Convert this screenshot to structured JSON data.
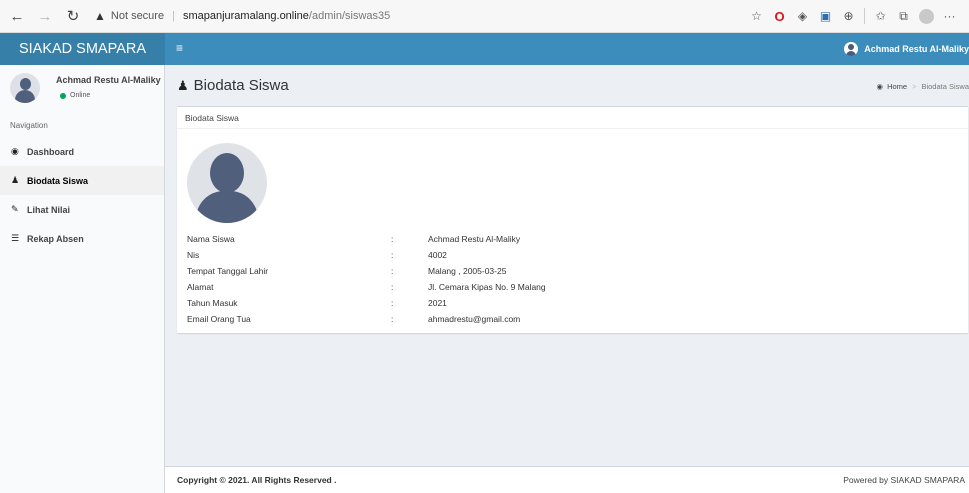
{
  "browser": {
    "back_glyph": "←",
    "forward_glyph": "→",
    "reload_glyph": "↻",
    "warning_glyph": "▲",
    "security_label": "Not secure",
    "url_host": "smapanjuramalang.online",
    "url_path": "/admin/siswas35",
    "icons": [
      "reading-view-icon",
      "opera-icon",
      "extension-icon",
      "flag-icon",
      "globe-icon",
      "favorites-icon",
      "collections-icon",
      "profile-icon",
      "more-icon"
    ],
    "star_glyph": "☆",
    "opera_glyph": "O",
    "ext_glyph": "◈",
    "flag_glyph": "▣",
    "globe_glyph": "⊕",
    "fav_glyph": "✩",
    "collections_glyph": "⧉",
    "more_glyph": "···"
  },
  "header": {
    "brand": "SIAKAD SMAPARA",
    "menu_glyph": "≡",
    "user_name": "Achmad Restu Al-Maliky",
    "bg_color": "#3c8dbc",
    "logo_color": "#367fa9"
  },
  "sidebar": {
    "user_name": "Achmad Restu Al-Maliky",
    "status": "Online",
    "status_color": "#00a65a",
    "nav_header": "Navigation",
    "items": [
      {
        "label": "Dashboard",
        "icon": "dashboard-icon",
        "glyph": "◉"
      },
      {
        "label": "Biodata Siswa",
        "icon": "user-icon",
        "glyph": "♟",
        "active": true
      },
      {
        "label": "Lihat Nilai",
        "icon": "pencil-icon",
        "glyph": "✎"
      },
      {
        "label": "Rekap Absen",
        "icon": "list-icon",
        "glyph": "☰"
      }
    ]
  },
  "page": {
    "title": "Biodata Siswa",
    "title_glyph": "♟",
    "breadcrumb": {
      "home_glyph": "◉",
      "home": "Home",
      "sep": ">",
      "current": "Biodata Siswa"
    },
    "box_title": "Biodata Siswa",
    "fields": [
      {
        "label": "Nama Siswa",
        "colon": ":",
        "value": "Achmad Restu Al-Maliky"
      },
      {
        "label": "Nis",
        "colon": ":",
        "value": "4002"
      },
      {
        "label": "Tempat Tanggal Lahir",
        "colon": ":",
        "value": "Malang , 2005-03-25"
      },
      {
        "label": "Alamat",
        "colon": ":",
        "value": "Jl. Cemara Kipas No. 9 Malang"
      },
      {
        "label": "Tahun Masuk",
        "colon": ":",
        "value": "2021"
      },
      {
        "label": "Email Orang Tua",
        "colon": ":",
        "value": "ahmadrestu@gmail.com"
      }
    ]
  },
  "footer": {
    "copyright": "Copyright © 2021. All Rights Reserved .",
    "powered": "Powered by SIAKAD SMAPARA"
  }
}
